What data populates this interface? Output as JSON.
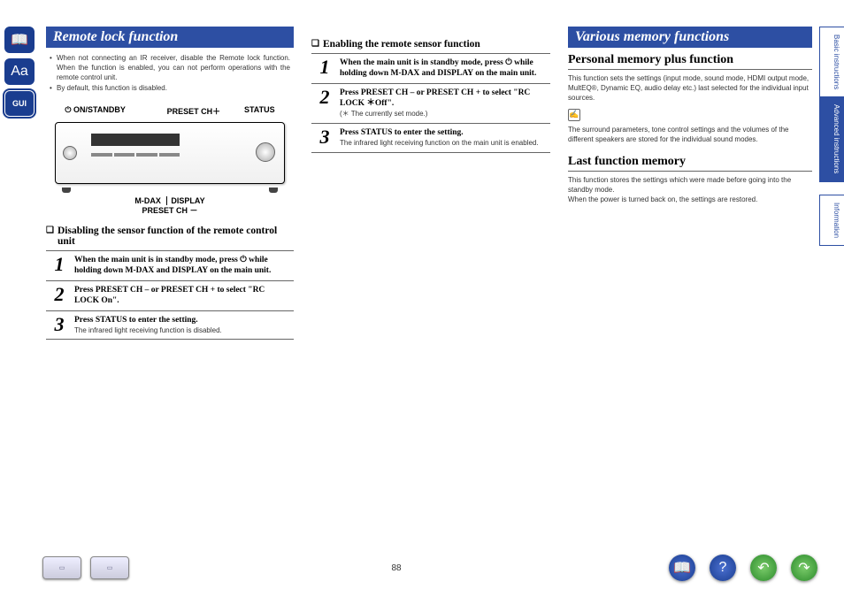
{
  "leftTabs": {
    "book": "📖",
    "aa": "Aa",
    "gui": "GUI"
  },
  "col1": {
    "title": "Remote lock function",
    "bullets": [
      "When not connecting an IR receiver, disable the Remote lock function. When the function is enabled, you can not perform operations with the remote control unit.",
      "By default, this function is disabled."
    ],
    "diagram": {
      "topLeft": "⏻ ON/STANDBY",
      "topMid": "PRESET CH＋",
      "topRight": "STATUS",
      "bot1": "M-DAX",
      "bot1b": "DISPLAY",
      "bot2": "PRESET CH －"
    },
    "sub1": "Disabling the sensor function of the remote control unit",
    "steps1": [
      {
        "bold": "When the main unit is in standby mode, press ⏻ while holding down M-DAX and DISPLAY on the main unit.",
        "note": ""
      },
      {
        "bold": "Press PRESET CH – or PRESET CH + to select \"RC LOCK On\".",
        "note": ""
      },
      {
        "bold": "Press STATUS to enter the setting.",
        "note": "The infrared light receiving function is disabled."
      }
    ]
  },
  "col2": {
    "sub1": "Enabling the remote sensor function",
    "steps1": [
      {
        "bold": "When the main unit is in standby mode, press ⏻ while holding down M-DAX and DISPLAY on the main unit.",
        "note": ""
      },
      {
        "bold": "Press PRESET CH – or PRESET CH + to select \"RC LOCK ＊Off\".",
        "note": "(＊ The currently set mode.)"
      },
      {
        "bold": "Press STATUS to enter the setting.",
        "note": "The infrared light receiving function on the main unit is enabled."
      }
    ]
  },
  "col3": {
    "title": "Various memory functions",
    "h2a": "Personal memory plus function",
    "pa": "This function sets the settings (input mode, sound mode, HDMI output mode, MultEQ®, Dynamic EQ, audio delay etc.) last selected for the individual input sources.",
    "pa2": "The surround parameters, tone control settings and the volumes of the different speakers are stored for the individual sound modes.",
    "h2b": "Last function memory",
    "pb": "This function stores the settings which were made before going into the standby mode.",
    "pb2": "When the power is turned back on, the settings are restored."
  },
  "rightTabs": {
    "basic": "Basic instructions",
    "advanced": "Advanced instructions",
    "info": "Information"
  },
  "footer": {
    "page": "88",
    "book": "📖",
    "help": "?",
    "back": "↶",
    "fwd": "↷"
  }
}
